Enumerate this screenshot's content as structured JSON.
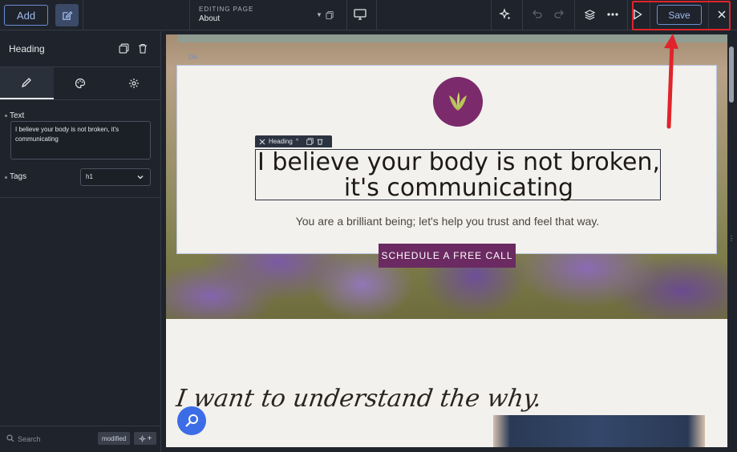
{
  "topbar": {
    "add_label": "Add",
    "editing_label": "EDITING PAGE",
    "page_name": "About",
    "save_label": "Save"
  },
  "sidebar": {
    "title": "Heading",
    "fields": {
      "text_label": "Text",
      "text_value": "I believe your body is not broken, it's communicating",
      "tags_label": "Tags",
      "tags_value": "h1"
    },
    "footer": {
      "search_placeholder": "Search",
      "status_badge": "modified"
    }
  },
  "canvas": {
    "div_label": "Div",
    "heading_toolbar_label": "Heading",
    "heading_text": "I believe your body is not broken, it's communicating",
    "subheading": "You are a brilliant being; let's help you trust and feel that way.",
    "cta_label": "SCHEDULE A FREE CALL",
    "section_script": "I want to understand the why."
  },
  "colors": {
    "accent_blue": "#6b8fd6",
    "brand_plum": "#6b2a61",
    "annotation_red": "#e0242b"
  }
}
